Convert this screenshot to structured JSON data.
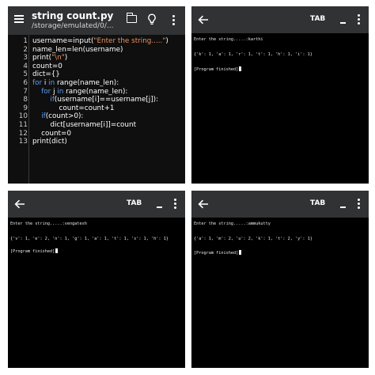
{
  "editor": {
    "title": "string count.py",
    "path": "/storage/emulated/0/...",
    "lines": [
      {
        "n": "1",
        "html": "username=input(<span class=\"str\">\"Enter the string.....\"</span>)"
      },
      {
        "n": "2",
        "html": "name_len=len(username)"
      },
      {
        "n": "3",
        "html": "print(<span class=\"str\">\"\\n\"</span>)"
      },
      {
        "n": "4",
        "html": "count=0"
      },
      {
        "n": "5",
        "html": "dict={}"
      },
      {
        "n": "6",
        "html": "<span class=\"kw\">for</span> i <span class=\"kw\">in</span> range(name_len):"
      },
      {
        "n": "7",
        "html": "    <span class=\"kw\">for</span> j <span class=\"kw\">in</span> range(name_len):"
      },
      {
        "n": "8",
        "html": "        <span class=\"kw\">if</span>(username[i]==username[j]):"
      },
      {
        "n": "9",
        "html": "            count=count+1"
      },
      {
        "n": "10",
        "html": "    <span class=\"kw\">if</span>(count&gt;0):"
      },
      {
        "n": "11",
        "html": "        dict[username[i]]=count"
      },
      {
        "n": "12",
        "html": "    count=0"
      },
      {
        "n": "13",
        "html": "print(dict)"
      }
    ]
  },
  "terminals": [
    {
      "tab_label": "TAB",
      "prompt_line": "Enter the string.....:karthi",
      "output_line": "{'k': 1, 'a': 1, 'r': 1, 't': 1, 'h': 1, 'i': 1}",
      "finished_line": "[Program finished]"
    },
    {
      "tab_label": "TAB",
      "prompt_line": "Enter the string.....:vengatesh",
      "output_line": "{'v': 1, 'e': 2, 'n': 1, 'g': 1, 'a': 1, 't': 1, 's': 1, 'h': 1}",
      "finished_line": "[Program finished]"
    },
    {
      "tab_label": "TAB",
      "prompt_line": "Enter the string.....:ammukutty",
      "output_line": "{'a': 1, 'm': 2, 'u': 2, 'k': 1, 't': 2, 'y': 1}",
      "finished_line": "[Program finished]"
    }
  ]
}
